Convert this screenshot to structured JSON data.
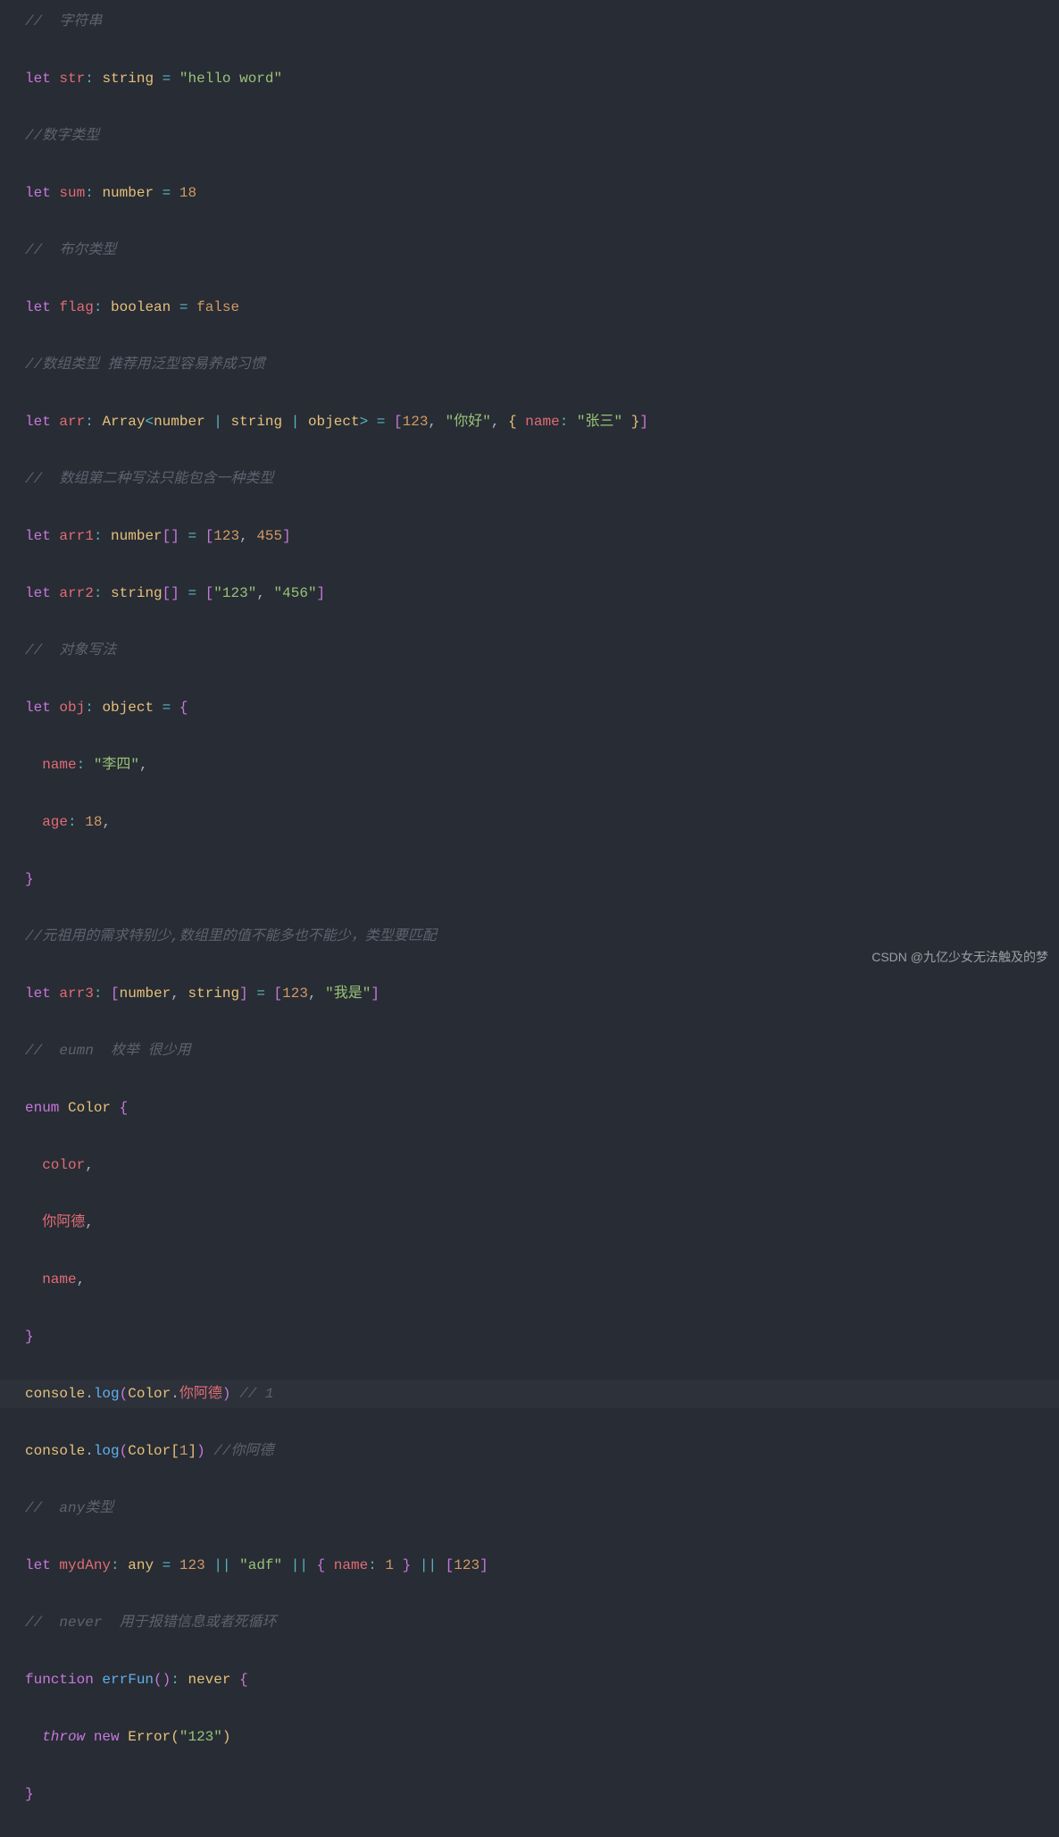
{
  "lines": {
    "c1": "//  字符串",
    "l2_let": "let",
    "l2_var": "str",
    "l2_type": "string",
    "l2_eq": "=",
    "l2_str": "\"hello word\"",
    "c3": "//数字类型",
    "l4_let": "let",
    "l4_var": "sum",
    "l4_type": "number",
    "l4_eq": "=",
    "l4_num": "18",
    "c5": "//  布尔类型",
    "l6_let": "let",
    "l6_var": "flag",
    "l6_type": "boolean",
    "l6_eq": "=",
    "l6_val": "false",
    "c7": "//数组类型 推荐用泛型容易养成习惯",
    "l8_let": "let",
    "l8_var": "arr",
    "l8_type": "Array",
    "l8_gen1": "number",
    "l8_gen2": "string",
    "l8_gen3": "object",
    "l8_eq": "=",
    "l8_a1": "123",
    "l8_a2": "\"你好\"",
    "l8_prop": "name",
    "l8_a3": "\"张三\"",
    "c9": "//  数组第二种写法只能包含一种类型",
    "l10_let": "let",
    "l10_var": "arr1",
    "l10_type": "number",
    "l10_eq": "=",
    "l10_a1": "123",
    "l10_a2": "455",
    "l11_let": "let",
    "l11_var": "arr2",
    "l11_type": "string",
    "l11_eq": "=",
    "l11_a1": "\"123\"",
    "l11_a2": "\"456\"",
    "c12": "//  对象写法",
    "l13_let": "let",
    "l13_var": "obj",
    "l13_type": "object",
    "l13_eq": "=",
    "l14_prop": "name",
    "l14_val": "\"李四\"",
    "l15_prop": "age",
    "l15_val": "18",
    "c17": "//元祖用的需求特别少,数组里的值不能多也不能少，类型要匹配",
    "l18_let": "let",
    "l18_var": "arr3",
    "l18_t1": "number",
    "l18_t2": "string",
    "l18_eq": "=",
    "l18_a1": "123",
    "l18_a2": "\"我是\"",
    "c19": "//  eumn  枚举 很少用",
    "l20_kw": "enum",
    "l20_name": "Color",
    "l21_val": "color",
    "l22_val": "你阿德",
    "l23_val": "name",
    "l25_obj": "console",
    "l25_fn": "log",
    "l25_c": "Color",
    "l25_p": "你阿德",
    "l25_cm": "// 1",
    "l26_obj": "console",
    "l26_fn": "log",
    "l26_c": "Color",
    "l26_i": "1",
    "l26_cm": "//你阿德",
    "c27": "//  any类型",
    "l28_let": "let",
    "l28_var": "mydAny",
    "l28_type": "any",
    "l28_eq": "=",
    "l28_n1": "123",
    "l28_s1": "\"adf\"",
    "l28_p": "name",
    "l28_n2": "1",
    "l28_n3": "123",
    "c29": "//  never  用于报错信息或者死循环",
    "l30_kw": "function",
    "l30_name": "errFun",
    "l30_ret": "never",
    "l31_throw": "throw",
    "l31_new": "new",
    "l31_err": "Error",
    "l31_msg": "\"123\""
  },
  "watermark": "CSDN @九亿少女无法触及的梦"
}
